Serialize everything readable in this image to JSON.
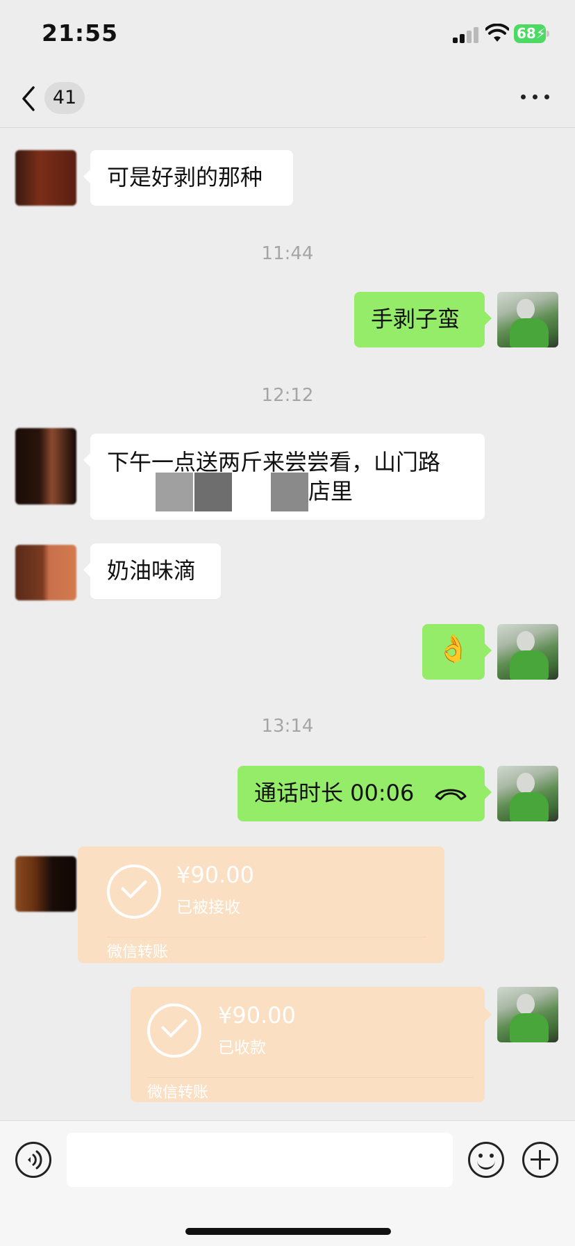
{
  "status_bar": {
    "time": "21:55",
    "battery": "68"
  },
  "nav": {
    "unread_count": "41"
  },
  "messages": {
    "m1": "可是好剥的那种",
    "ts1": "11:44",
    "m2": "手剥子蛮",
    "ts2": "12:12",
    "m3_line1": "下午一点送两斤来尝尝看，山门路",
    "m3_line2": "店里",
    "m4": "奶油味滴",
    "m5_emoji": "👌",
    "ts3": "13:14",
    "call_label": "通话时长 00:06"
  },
  "transfers": {
    "t1": {
      "amount": "¥90.00",
      "status": "已被接收",
      "footer": "微信转账"
    },
    "t2": {
      "amount": "¥90.00",
      "status": "已收款",
      "footer": "微信转账"
    }
  },
  "input": {
    "placeholder": ""
  },
  "colors": {
    "bubble_right": "#95ec69",
    "transfer": "#fbdfc2",
    "background": "#ededed"
  }
}
